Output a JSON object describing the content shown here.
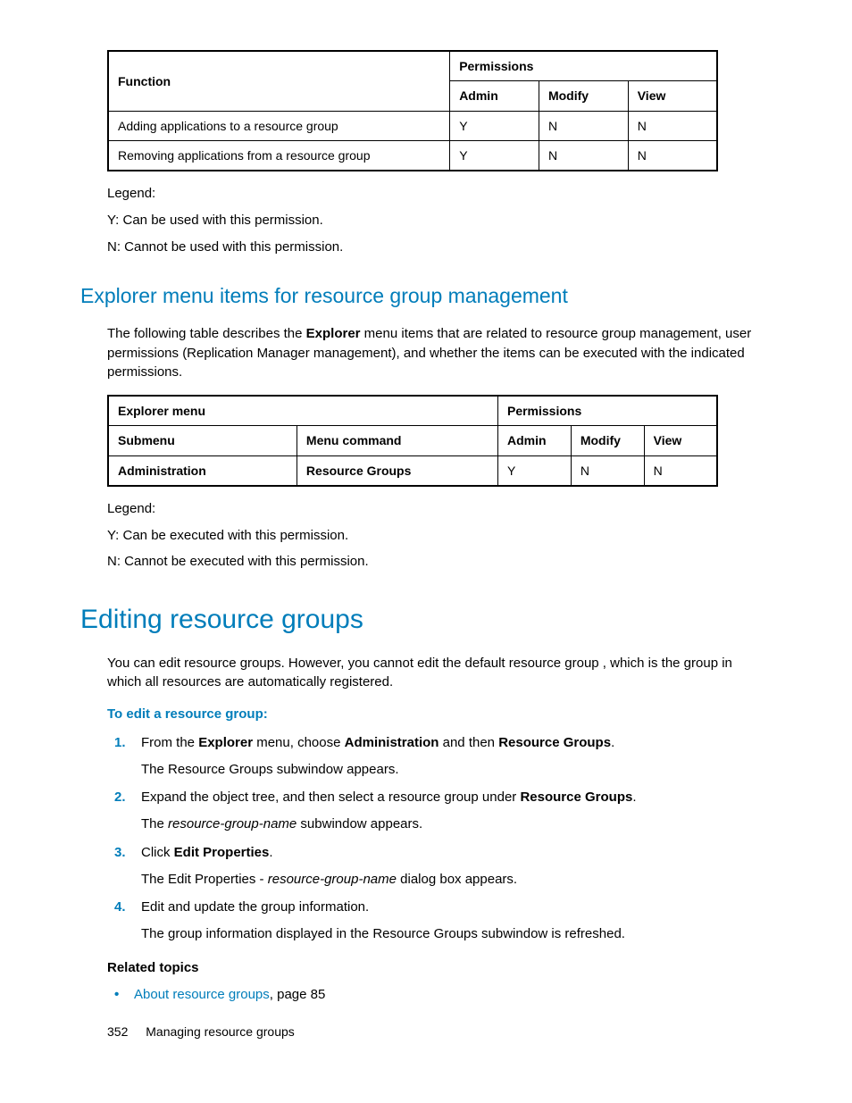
{
  "table1": {
    "h_function": "Function",
    "h_permissions": "Permissions",
    "h_admin": "Admin",
    "h_modify": "Modify",
    "h_view": "View",
    "rows": [
      {
        "fn": "Adding applications to a resource group",
        "a": "Y",
        "m": "N",
        "v": "N"
      },
      {
        "fn": "Removing applications from a resource group",
        "a": "Y",
        "m": "N",
        "v": "N"
      }
    ]
  },
  "legend1": {
    "title": "Legend:",
    "y": "Y: Can be used with this permission.",
    "n": "N: Cannot be used with this permission."
  },
  "section1": {
    "heading": "Explorer menu items for resource group management",
    "intro_1": "The following table describes the ",
    "intro_bold": "Explorer",
    "intro_2": " menu items that are related to resource group management, user permissions (Replication Manager management), and whether the items can be executed with the indicated permissions."
  },
  "table2": {
    "h_explorer": "Explorer menu",
    "h_permissions": "Permissions",
    "h_submenu": "Submenu",
    "h_menucmd": "Menu command",
    "h_admin": "Admin",
    "h_modify": "Modify",
    "h_view": "View",
    "rows": [
      {
        "sub": "Administration",
        "cmd": "Resource Groups",
        "a": "Y",
        "m": "N",
        "v": "N"
      }
    ]
  },
  "legend2": {
    "title": "Legend:",
    "y": "Y: Can be executed with this permission.",
    "n": "N: Cannot be executed with this permission."
  },
  "section2": {
    "heading": "Editing resource groups",
    "intro": "You can edit resource groups. However, you cannot edit the default resource group                                   , which is the group in which all resources are automatically registered.",
    "subhead": "To edit a resource group:",
    "steps": [
      {
        "parts": [
          {
            "t": "From the "
          },
          {
            "t": "Explorer",
            "b": true
          },
          {
            "t": " menu, choose "
          },
          {
            "t": "Administration",
            "b": true
          },
          {
            "t": " and then "
          },
          {
            "t": "Resource Groups",
            "b": true
          },
          {
            "t": "."
          }
        ],
        "sub": [
          {
            "t": "The Resource Groups subwindow appears."
          }
        ]
      },
      {
        "parts": [
          {
            "t": "Expand the object tree, and then select a resource group under "
          },
          {
            "t": "Resource Groups",
            "b": true
          },
          {
            "t": "."
          }
        ],
        "sub": [
          {
            "t": "The "
          },
          {
            "t": "resource-group-name",
            "i": true
          },
          {
            "t": " subwindow appears."
          }
        ]
      },
      {
        "parts": [
          {
            "t": "Click "
          },
          {
            "t": "Edit Properties",
            "b": true
          },
          {
            "t": "."
          }
        ],
        "sub": [
          {
            "t": "The Edit Properties - "
          },
          {
            "t": "resource-group-name",
            "i": true
          },
          {
            "t": " dialog box appears."
          }
        ]
      },
      {
        "parts": [
          {
            "t": "Edit and update the group information."
          }
        ],
        "sub": [
          {
            "t": "The group information displayed in the Resource Groups subwindow is refreshed."
          }
        ]
      }
    ],
    "related_label": "Related topics",
    "related_link": "About resource groups",
    "related_suffix": ", page 85"
  },
  "footer": {
    "page": "352",
    "title": "Managing resource groups"
  }
}
